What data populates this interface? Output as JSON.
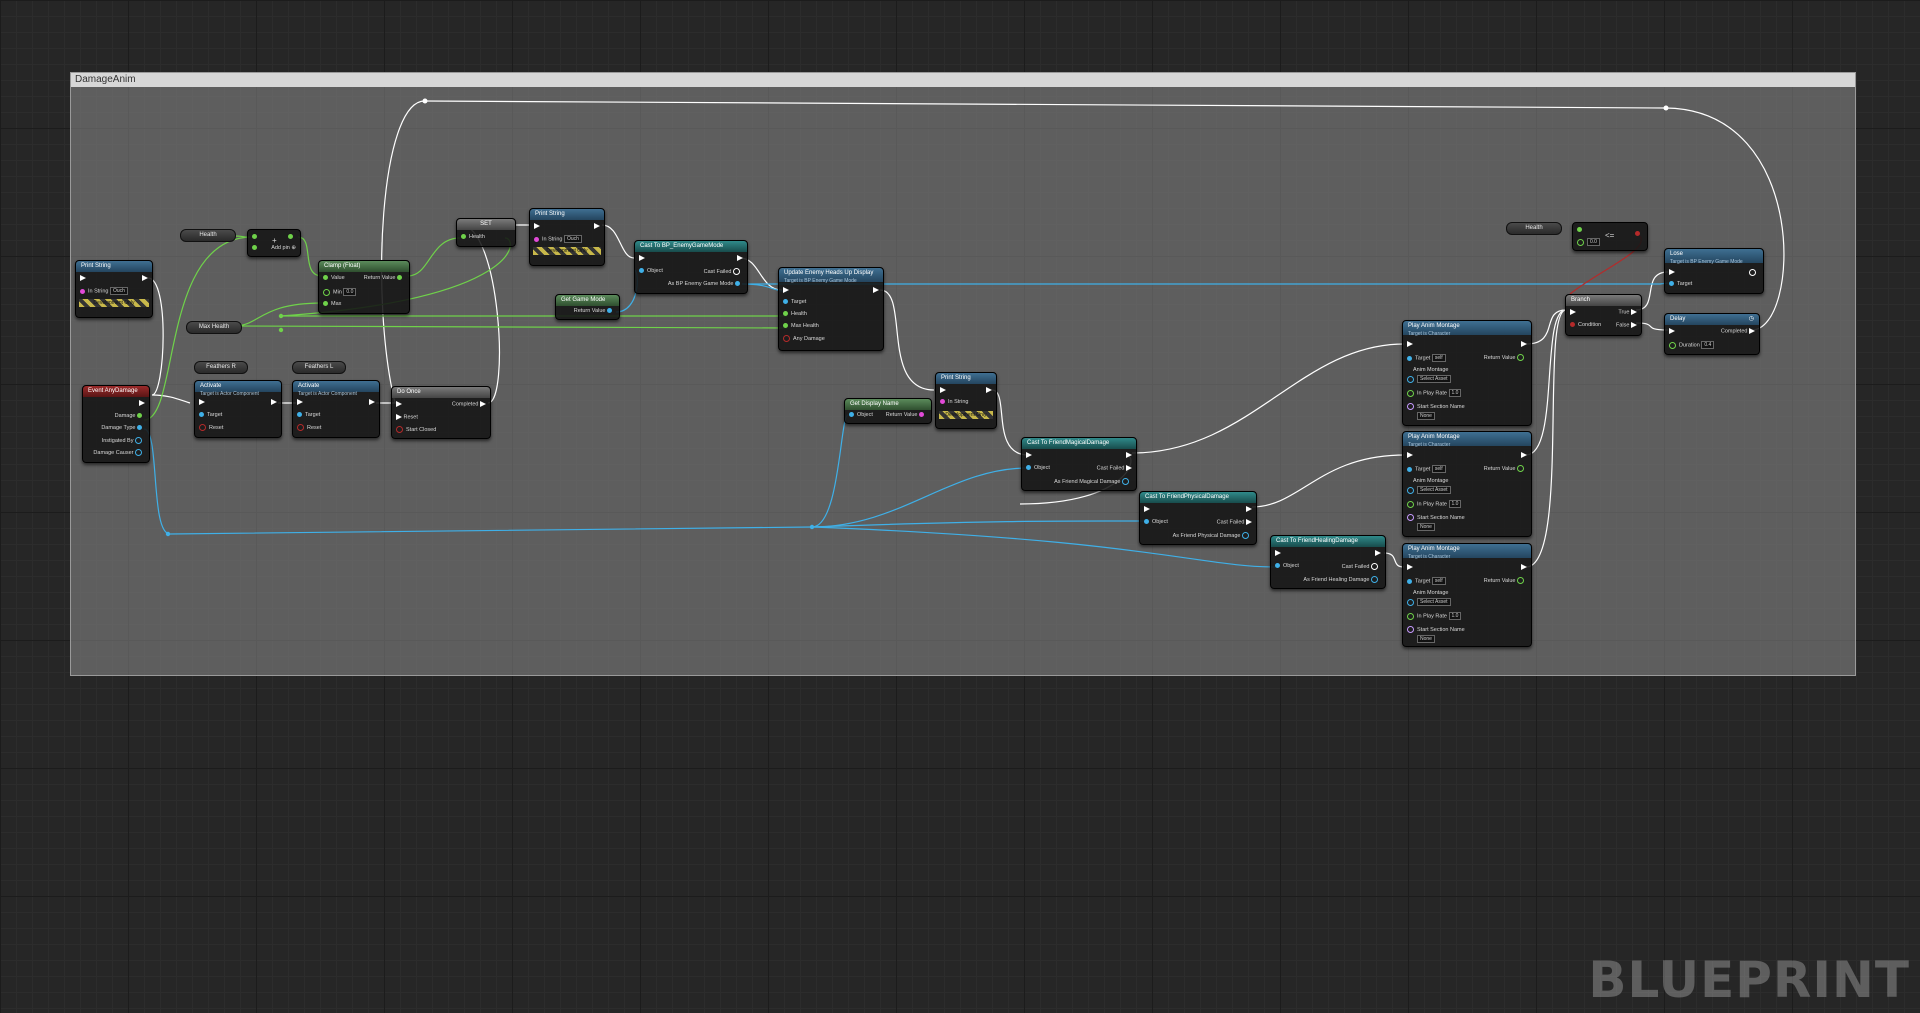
{
  "comment_title": "DamageAnim",
  "watermark": "BLUEPRINT",
  "nodes": {
    "print_string_1": {
      "title": "Print String",
      "in_string": "In String",
      "value": "Ouch",
      "dev": "Development Only"
    },
    "event_any_damage": {
      "title": "Event AnyDamage",
      "pins": [
        "Damage",
        "Damage Type",
        "Instigated By",
        "Damage Causer"
      ]
    },
    "health_var": "Health",
    "max_health_var": "Max Health",
    "add_node": {
      "label": "Add pin",
      "symbol": "+"
    },
    "clamp_float": {
      "title": "Clamp (Float)",
      "value": "Value",
      "min": "Min",
      "min_val": "0.0",
      "max": "Max",
      "ret": "Return Value"
    },
    "set_node": {
      "title": "SET",
      "health": "Health"
    },
    "print_string_2": {
      "title": "Print String",
      "in_string": "In String",
      "value": "Ouch",
      "dev": "Development Only"
    },
    "feathers_r": "Feathers R",
    "feathers_l": "Feathers L",
    "activate_1": {
      "title": "Activate",
      "sub": "Target is Actor Component",
      "target": "Target",
      "reset": "Reset"
    },
    "activate_2": {
      "title": "Activate",
      "sub": "Target is Actor Component",
      "target": "Target",
      "reset": "Reset"
    },
    "do_once": {
      "title": "Do Once",
      "completed": "Completed",
      "reset": "Reset",
      "start_closed": "Start Closed"
    },
    "cast_enemy_gm": {
      "title": "Cast To BP_EnemyGameMode",
      "object": "Object",
      "failed": "Cast Failed",
      "as": "As BP Enemy Game Mode"
    },
    "get_game_mode": {
      "title": "Get Game Mode",
      "ret": "Return Value"
    },
    "update_hud": {
      "title": "Update Enemy Heads Up Display",
      "sub": "Target is BP Enemy Game Mode",
      "pins": [
        "Target",
        "Health",
        "Max Health",
        "Any Damage"
      ]
    },
    "get_display_name": {
      "title": "Get Display Name",
      "object": "Object",
      "ret": "Return Value"
    },
    "print_string_3": {
      "title": "Print String",
      "in_string": "In String",
      "dev": "Development Only"
    },
    "cast_magical": {
      "title": "Cast To FriendMagicalDamage",
      "object": "Object",
      "failed": "Cast Failed",
      "as": "As Friend Magical Damage"
    },
    "cast_physical": {
      "title": "Cast To FriendPhysicalDamage",
      "object": "Object",
      "failed": "Cast Failed",
      "as": "As Friend Physical Damage"
    },
    "cast_healing": {
      "title": "Cast To FriendHealingDamage",
      "object": "Object",
      "failed": "Cast Failed",
      "as": "As Friend Healing Damage"
    },
    "montage": {
      "title": "Play Anim Montage",
      "sub": "Target is Character",
      "target": "Target",
      "self": "self",
      "ret": "Return Value",
      "anim": "Anim Montage",
      "select": "Select Asset",
      "rate": "In Play Rate",
      "rate_val": "1.0",
      "section": "Start Section Name",
      "none": "None"
    },
    "health_var_2": "Health",
    "compare": {
      "symbol": "<=",
      "val": "0.0"
    },
    "branch": {
      "title": "Branch",
      "cond": "Condition",
      "true": "True",
      "false": "False"
    },
    "lose": {
      "title": "Lose",
      "sub": "Target is BP Enemy Game Mode",
      "target": "Target"
    },
    "delay": {
      "title": "Delay",
      "completed": "Completed",
      "duration": "Duration",
      "dur_val": "0.4"
    }
  }
}
